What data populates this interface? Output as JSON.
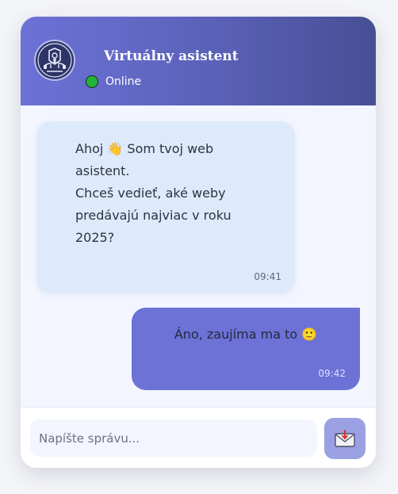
{
  "header": {
    "title": "Virtuálny asistent",
    "status": "Online",
    "avatar_icon": "robot-mascot-icon",
    "status_color": "#22b33a",
    "gradient_start": "#6c72d6",
    "gradient_end": "#474f94"
  },
  "messages": [
    {
      "sender": "bot",
      "text": "Ahoj 👋 Som tvoj web asistent.\nChceš vedieť, aké weby predávajú najviac v roku 2025?",
      "time": "09:41",
      "bubble_color": "#ddeafb"
    },
    {
      "sender": "user",
      "text": "Áno, zaujíma ma to 🙂",
      "time": "09:42",
      "bubble_color": "#6c72d6"
    }
  ],
  "composer": {
    "placeholder": "Napíšte správu...",
    "value": "",
    "send_icon": "envelope-send-icon",
    "send_color": "#9aa0e2"
  }
}
